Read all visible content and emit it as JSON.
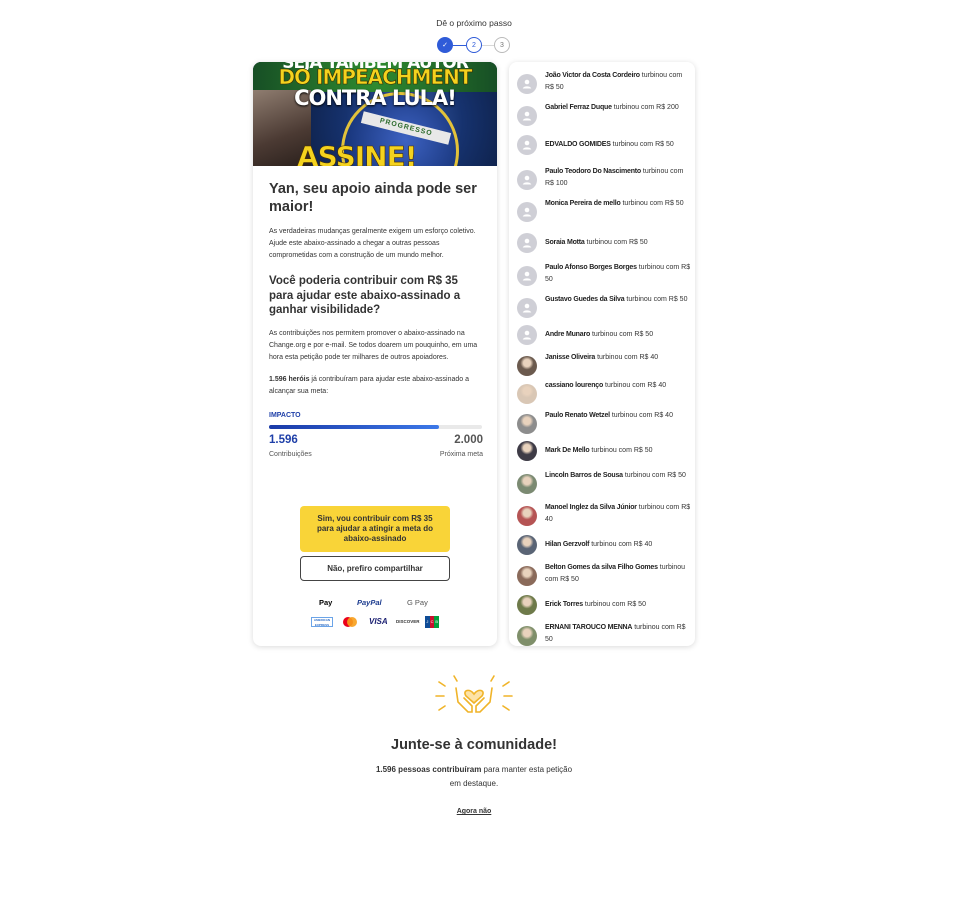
{
  "stepper": {
    "title": "Dê o próximo passo",
    "steps": [
      "✓",
      "2",
      "3"
    ]
  },
  "banner": {
    "line0": "SEJA TAMBÉM AUTOR",
    "line1": "DO IMPEACHMENT",
    "line2": "CONTRA LULA!",
    "line3": "ASSINE!",
    "band": "PROGRESSO"
  },
  "main": {
    "heading": "Yan, seu apoio ainda pode ser maior!",
    "intro": "As verdadeiras mudanças geralmente exigem um esforço coletivo. Ajude este abaixo-assinado a chegar a outras pessoas comprometidas com a construção de um mundo melhor.",
    "question": "Você poderia contribuir com R$ 35 para ajudar este abaixo-assinado a ganhar visibilidade?",
    "explain": "As contribuições nos permitem promover o abaixo-assinado na Change.org e por e-mail. Se todos doarem um pouquinho, em uma hora esta petição pode ter milhares de outros apoiadores.",
    "heroes_bold": "1.596 heróis",
    "heroes_rest": " já contribuíram para ajudar este abaixo-assinado a alcançar sua meta:",
    "impact_label": "IMPACTO",
    "progress_fraction": 0.798,
    "current_count": "1.596",
    "current_label": "Contribuições",
    "goal_count": "2.000",
    "goal_label": "Próxima meta",
    "yes_button": "Sim, vou contribuir com R$ 35 para ajudar a atingir a meta do abaixo-assinado",
    "no_button": "Não, prefiro compartilhar"
  },
  "payment": {
    "apple_pay": " Pay",
    "paypal": "PayPal",
    "google_pay": "G Pay",
    "amex": "AMERICAN EXPRESS",
    "visa": "VISA",
    "discover": "DISCOVER",
    "jcb": [
      "J",
      "C",
      "B"
    ]
  },
  "donors": [
    {
      "name": "João Victor da Costa Cordeiro",
      "text": " turbinou com R$ 50"
    },
    {
      "name": "Gabriel Ferraz Duque",
      "text": " turbinou com R$ 200"
    },
    {
      "name": "EDVALDO GOMIDES",
      "text": " turbinou com R$ 50"
    },
    {
      "name": "Paulo Teodoro Do Nascimento",
      "text": " turbinou com R$ 100"
    },
    {
      "name": "Monica Pereira de mello",
      "text": " turbinou com R$ 50"
    },
    {
      "name": "Soraia Motta",
      "text": " turbinou com R$ 50"
    },
    {
      "name": "Paulo Afonso Borges Borges",
      "text": " turbinou com R$ 50"
    },
    {
      "name": "Gustavo Guedes da Silva",
      "text": " turbinou com R$ 50"
    },
    {
      "name": "Andre Munaro",
      "text": " turbinou com R$ 50"
    },
    {
      "name": "Janisse Oliveira",
      "text": " turbinou com R$ 40"
    },
    {
      "name": "cassiano lourenço",
      "text": " turbinou com R$ 40"
    },
    {
      "name": "Paulo Renato Wetzel",
      "text": " turbinou com R$ 40"
    },
    {
      "name": "Mark De Mello",
      "text": " turbinou com R$ 50"
    },
    {
      "name": "Lincoln Barros de Sousa",
      "text": " turbinou com R$ 50"
    },
    {
      "name": "Manoel Inglez da Silva Júnior",
      "text": " turbinou com R$ 40"
    },
    {
      "name": "Hilan Gerzvolf",
      "text": " turbinou com R$ 40"
    },
    {
      "name": "Belton Gomes da silva Filho Gomes",
      "text": " turbinou com R$ 50"
    },
    {
      "name": "Erick Torres",
      "text": " turbinou com R$ 50"
    },
    {
      "name": "ERNANI TAROUCO MENNA",
      "text": " turbinou com R$ 50"
    }
  ],
  "community": {
    "title": "Junte-se à comunidade!",
    "count_bold": "1.596 pessoas contribuíram",
    "count_rest": " para manter esta petição em destaque.",
    "later": "Agora não"
  },
  "colors": {
    "accent": "#2f5bd8",
    "cta": "#f9d438",
    "impact": "#1e3fa8"
  }
}
